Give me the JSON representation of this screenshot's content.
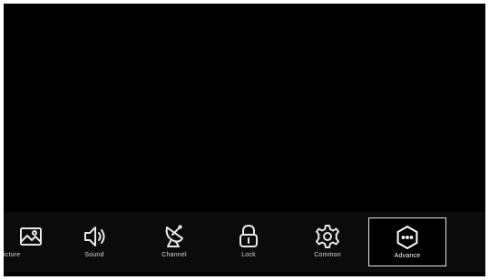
{
  "menu": {
    "items": [
      {
        "label": "icture",
        "icon": "picture-icon",
        "selected": false
      },
      {
        "label": "Sound",
        "icon": "speaker-icon",
        "selected": false
      },
      {
        "label": "Channel",
        "icon": "satellite-dish-icon",
        "selected": false
      },
      {
        "label": "Lock",
        "icon": "lock-icon",
        "selected": false
      },
      {
        "label": "Common",
        "icon": "gear-icon",
        "selected": false
      },
      {
        "label": "Advance",
        "icon": "more-options-icon",
        "selected": true
      }
    ]
  },
  "colors": {
    "screen_background": "#000000",
    "bar_background": "#0b0b0b",
    "icon_stroke": "#e8e8e8",
    "selection_border": "#e6e6e6"
  }
}
